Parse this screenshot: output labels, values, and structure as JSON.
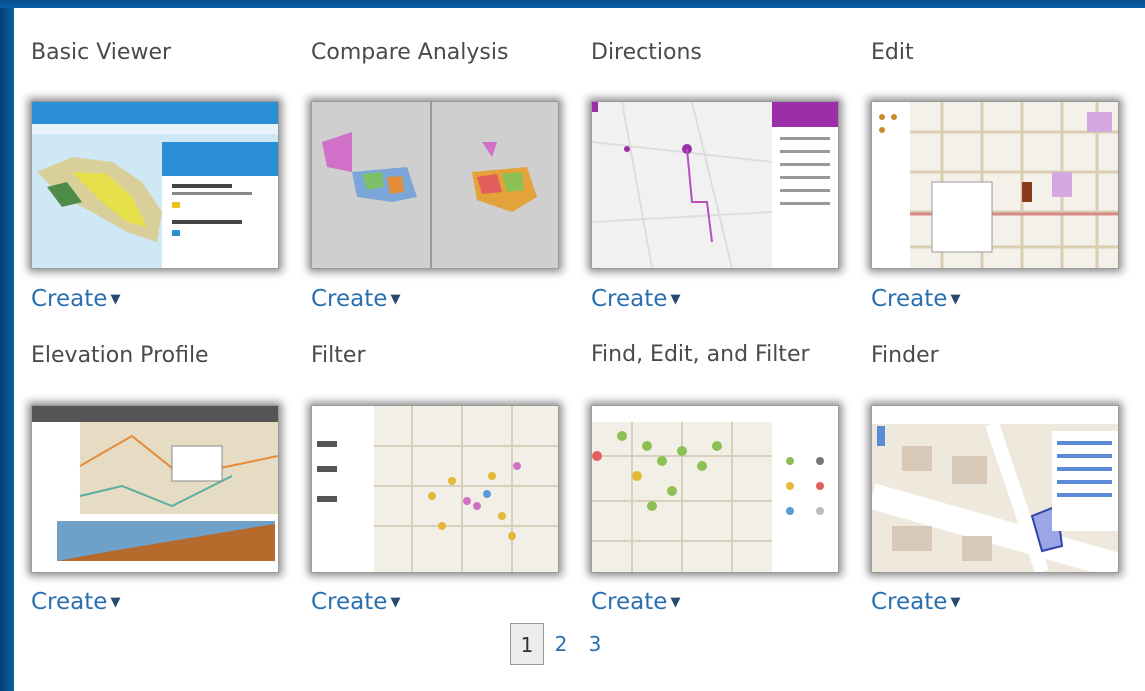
{
  "gallery": {
    "cards": [
      {
        "title": "Basic Viewer",
        "action": "Create"
      },
      {
        "title": "Compare Analysis",
        "action": "Create"
      },
      {
        "title": "Directions",
        "action": "Create"
      },
      {
        "title": "Edit",
        "action": "Create"
      },
      {
        "title": "Elevation Profile",
        "action": "Create"
      },
      {
        "title": "Filter",
        "action": "Create"
      },
      {
        "title": "Find, Edit, and Filter",
        "action": "Create"
      },
      {
        "title": "Finder",
        "action": "Create"
      }
    ],
    "caret_icon": "caret-down-icon"
  },
  "pagination": {
    "pages": [
      "1",
      "2",
      "3"
    ],
    "current": "1"
  },
  "colors": {
    "background_border": "#0a5fa8",
    "link": "#2a6fb0",
    "title": "#4a4a4a"
  }
}
